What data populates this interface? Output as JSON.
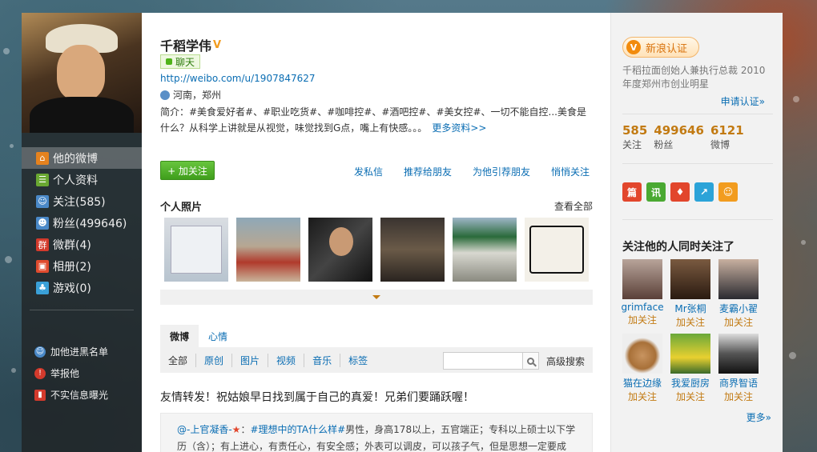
{
  "profile": {
    "name": "千稻学伟",
    "verified_mark": "V",
    "chat_label": "聊天",
    "url": "http://weibo.com/u/1907847627",
    "location": "河南，郑州",
    "intro": "简介：#美食爱好者#、#职业吃货#、#咖啡控#、#酒吧控#、#美女控#、一切不能自控...美食是什么？从科学上讲就是从视觉，味觉找到G点，嘴上有快感。。。",
    "more_info": "更多资料>>"
  },
  "actions": {
    "follow": "+ 加关注",
    "links": [
      "发私信",
      "推荐给朋友",
      "为他引荐朋友",
      "悄悄关注"
    ]
  },
  "photos": {
    "title": "个人照片",
    "view_all": "查看全部"
  },
  "left_nav": {
    "items": [
      {
        "label": "他的微博",
        "icon": "home-icon",
        "color": "#e6821e"
      },
      {
        "label": "个人资料",
        "icon": "profile-icon",
        "color": "#6aa832"
      },
      {
        "label": "关注(585)",
        "icon": "follow-icon",
        "color": "#4a89c8"
      },
      {
        "label": "粉丝(499646)",
        "icon": "fans-icon",
        "color": "#4a89c8"
      },
      {
        "label": "微群(4)",
        "icon": "group-icon",
        "color": "#d33a2c"
      },
      {
        "label": "相册(2)",
        "icon": "album-icon",
        "color": "#e04b2e"
      },
      {
        "label": "游戏(0)",
        "icon": "game-icon",
        "color": "#3aa0d8"
      }
    ],
    "links": [
      {
        "label": "加他进黑名单",
        "icon": "blacklist-icon",
        "color": "#4a89c8"
      },
      {
        "label": "举报他",
        "icon": "report-icon",
        "color": "#d33a2c"
      },
      {
        "label": "不实信息曝光",
        "icon": "rumor-icon",
        "color": "#d33a2c"
      }
    ]
  },
  "feed": {
    "tabs": [
      "微博",
      "心情"
    ],
    "filters": [
      "全部",
      "原创",
      "图片",
      "视频",
      "音乐",
      "标签"
    ],
    "advanced_search": "高级搜索",
    "search_placeholder": "",
    "post_text": "友情转发！祝姑娘早日找到属于自己的真爱！兄弟们要踊跃喔！",
    "repost_user": "@-上官凝香-",
    "repost_tag": "#理想中的TA什么样#",
    "repost_line1_rest": "男性，身高178以上，五官端正；专科以上硕士以下学",
    "repost_line2": "历（含）；有上进心，有责任心，有安全感；外表可以调皮，可以孩子气，但是思想一定要成"
  },
  "right": {
    "verify_label": "新浪认证",
    "verify_desc": "千稻拉面创始人兼执行总裁 2010年度郑州市创业明星",
    "apply": "申请认证»",
    "stats": [
      {
        "num": "585",
        "label": "关注"
      },
      {
        "num": "499646",
        "label": "粉丝"
      },
      {
        "num": "6121",
        "label": "微博"
      }
    ],
    "share_icons": [
      {
        "name": "share-icon-1",
        "glyph": "篇",
        "color": "#e2462c"
      },
      {
        "name": "share-icon-2",
        "glyph": "讯",
        "color": "#4aa932"
      },
      {
        "name": "share-icon-3",
        "glyph": "♦",
        "color": "#e2462c"
      },
      {
        "name": "share-icon-4",
        "glyph": "↗",
        "color": "#2ba3d8"
      },
      {
        "name": "share-icon-5",
        "glyph": "☺",
        "color": "#f29c1f"
      }
    ],
    "also_title": "关注他的人同时关注了",
    "fans": [
      {
        "name": "grimface",
        "follow": "加关注",
        "bg": "#8a7468"
      },
      {
        "name": "Mr张桐",
        "follow": "加关注",
        "bg": "#5a4030"
      },
      {
        "name": "麦霸小翟",
        "follow": "加关注",
        "bg": "#3a3a40"
      },
      {
        "name": "猫在边缘",
        "follow": "加关注",
        "bg": "#c89460"
      },
      {
        "name": "我爱厨房",
        "follow": "加关注",
        "bg": "#4f8a2a"
      },
      {
        "name": "商界智语",
        "follow": "加关注",
        "bg": "#2a2a2a"
      }
    ],
    "more": "更多»"
  }
}
